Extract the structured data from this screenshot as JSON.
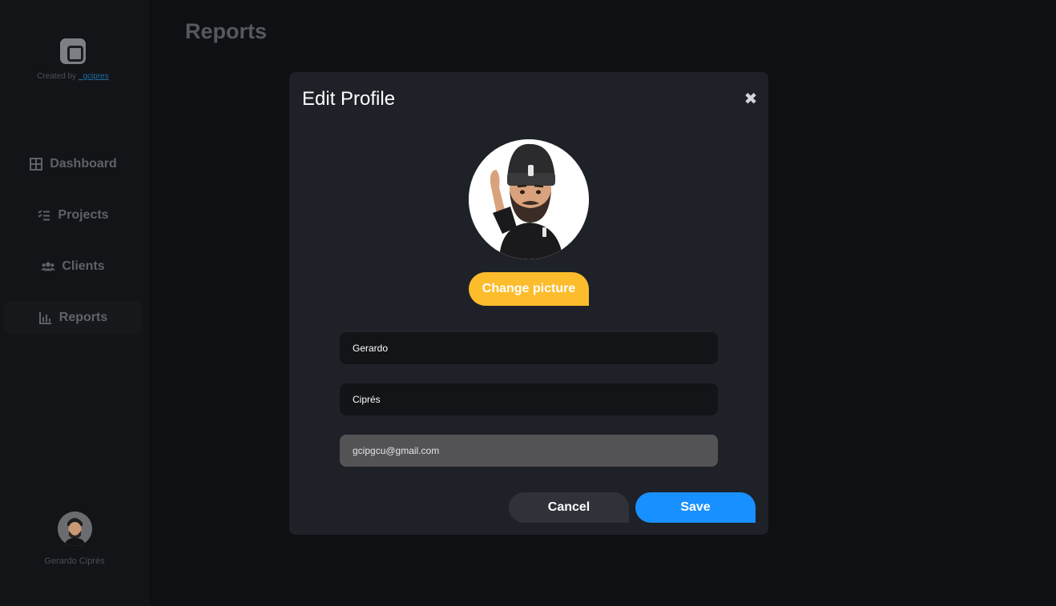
{
  "sidebar": {
    "created_prefix": "Created by",
    "created_link": "_gcipres",
    "items": [
      {
        "label": "Dashboard",
        "icon": "grid-icon"
      },
      {
        "label": "Projects",
        "icon": "checklist-icon"
      },
      {
        "label": "Clients",
        "icon": "users-icon"
      },
      {
        "label": "Reports",
        "icon": "bar-chart-icon"
      }
    ],
    "user_name": "Gerardo Ciprés"
  },
  "page": {
    "title": "Reports"
  },
  "modal": {
    "title": "Edit Profile",
    "change_picture_label": "Change picture",
    "first_name": "Gerardo",
    "last_name": "Ciprés",
    "email": "gcipgcu@gmail.com",
    "cancel_label": "Cancel",
    "save_label": "Save"
  },
  "colors": {
    "accent_yellow": "#fdbc2c",
    "accent_blue": "#1890ff",
    "modal_bg": "#1f2128",
    "sidebar_bg": "#131418"
  }
}
